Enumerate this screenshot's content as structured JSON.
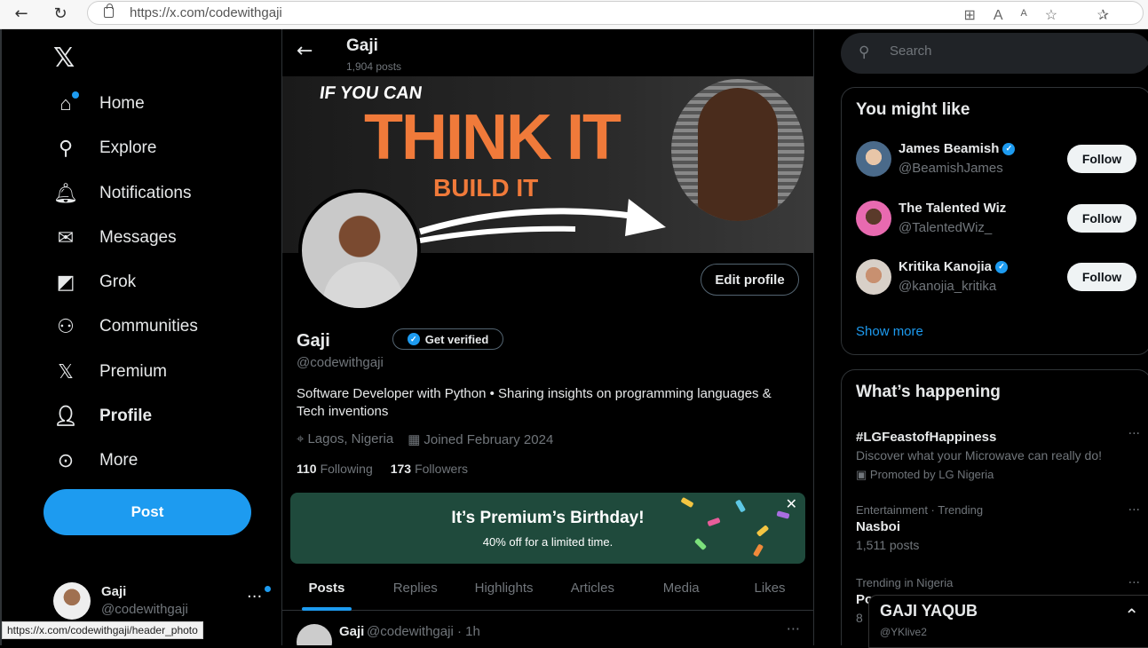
{
  "browser": {
    "url": "https://x.com/codewithgaji",
    "status_url": "https://x.com/codewithgaji/header_photo"
  },
  "nav": {
    "items": [
      {
        "label": "Home",
        "icon": "home-icon"
      },
      {
        "label": "Explore",
        "icon": "search-icon"
      },
      {
        "label": "Notifications",
        "icon": "bell-icon"
      },
      {
        "label": "Messages",
        "icon": "mail-icon"
      },
      {
        "label": "Grok",
        "icon": "grok-icon"
      },
      {
        "label": "Communities",
        "icon": "people-icon"
      },
      {
        "label": "Premium",
        "icon": "x-logo-icon"
      },
      {
        "label": "Profile",
        "icon": "person-icon"
      },
      {
        "label": "More",
        "icon": "more-circle-icon"
      }
    ],
    "post_label": "Post"
  },
  "account": {
    "name": "Gaji",
    "handle": "@codewithgaji"
  },
  "header": {
    "name": "Gaji",
    "posts": "1,904 posts"
  },
  "banner": {
    "line1": "IF YOU CAN",
    "line2": "THINK IT",
    "line3": "BUILD IT"
  },
  "profile": {
    "name": "Gaji",
    "get_verified": "Get verified",
    "handle": "@codewithgaji",
    "edit_label": "Edit profile",
    "bio": "Software Developer with Python • Sharing insights on programming languages & Tech inventions",
    "location": "Lagos, Nigeria",
    "joined": "Joined February 2024",
    "following_count": "110",
    "following_label": "Following",
    "followers_count": "173",
    "followers_label": "Followers"
  },
  "promo": {
    "title": "It’s Premium’s Birthday!",
    "subtitle": "40% off for a limited time."
  },
  "tabs": [
    "Posts",
    "Replies",
    "Highlights",
    "Articles",
    "Media",
    "Likes"
  ],
  "tweet": {
    "name": "Gaji",
    "meta": "@codewithgaji · 1h"
  },
  "search": {
    "placeholder": "Search"
  },
  "suggestions": {
    "title": "You might like",
    "follow_label": "Follow",
    "items": [
      {
        "name": "James Beamish",
        "handle": "@BeamishJames",
        "verified": true
      },
      {
        "name": "The Talented Wiz",
        "handle": "@TalentedWiz_",
        "verified": false
      },
      {
        "name": "Kritika Kanojia",
        "handle": "@kanojia_kritika",
        "verified": true
      }
    ],
    "show_more": "Show more"
  },
  "trends": {
    "title": "What’s happening",
    "items": [
      {
        "context": "",
        "title": "#LGFeastofHappiness",
        "desc": "Discover what your Microwave can really do!",
        "extra": "Promoted by LG Nigeria"
      },
      {
        "context": "Entertainment · Trending",
        "title": "Nasboi",
        "desc": "1,511 posts",
        "extra": ""
      },
      {
        "context": "Trending in Nigeria",
        "title": "Po",
        "desc": "8",
        "extra": ""
      }
    ]
  },
  "popup": {
    "name": "GAJI YAQUB",
    "handle": "@YKlive2"
  },
  "colors": {
    "accent": "#1d9bf0",
    "background": "#000000",
    "promo": "#1f4a3c",
    "banner_text": "#f07a3a"
  }
}
